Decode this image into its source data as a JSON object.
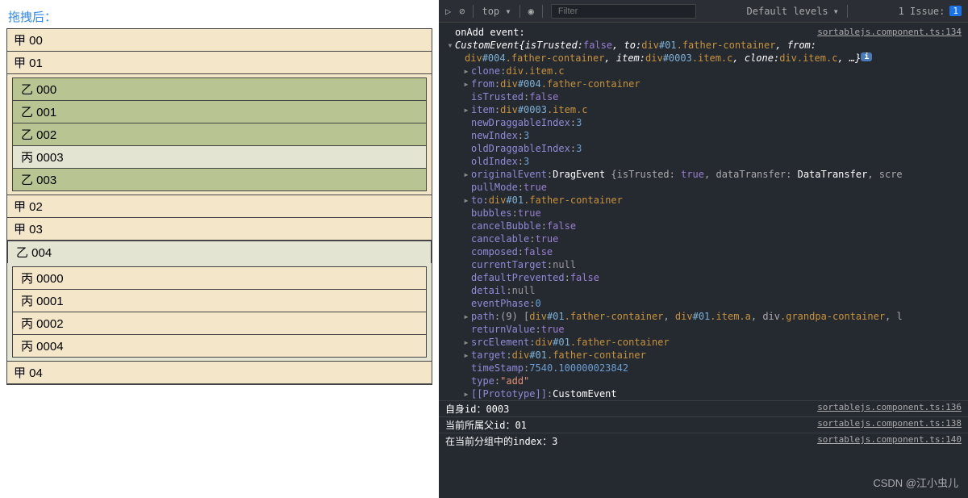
{
  "left": {
    "title": "拖拽后：",
    "itemsA": [
      "甲 00",
      "甲 01"
    ],
    "group1": [
      "乙 000",
      "乙 001",
      "乙 002",
      "丙 0003",
      "乙 003"
    ],
    "group1_c_index": 3,
    "itemsA2": [
      "甲 02",
      "甲 03"
    ],
    "row_b_single": "乙 004",
    "group2": [
      "丙 0000",
      "丙 0001",
      "丙 0002",
      "丙 0004"
    ],
    "itemsA3": [
      "甲 04"
    ]
  },
  "toolbar": {
    "top": "top",
    "filter_placeholder": "Filter",
    "levels": "Default levels",
    "issue_label": "1 Issue:",
    "issue_count": "1"
  },
  "console": {
    "header_label": "onAdd event:",
    "header_src": "sortablejs.component.ts:134",
    "summary_type": "CustomEvent",
    "summary_line1_parts": [
      "{isTrusted: ",
      "false",
      ", to: ",
      "div",
      "#01",
      ".father-container",
      ", from:"
    ],
    "summary_line2_parts": [
      "div",
      "#004",
      ".father-container",
      ", item: ",
      "div",
      "#0003",
      ".item.c",
      ", clone: ",
      "div.item.c",
      ", …}"
    ],
    "props": [
      {
        "tri": true,
        "key": "clone",
        "kind": "sel",
        "val_parts": [
          "div",
          ".item.c"
        ]
      },
      {
        "tri": true,
        "key": "from",
        "kind": "sel",
        "val_parts": [
          "div",
          "#004",
          ".father-container"
        ]
      },
      {
        "tri": false,
        "key": "isTrusted",
        "kind": "bool",
        "val": "false"
      },
      {
        "tri": true,
        "key": "item",
        "kind": "sel",
        "val_parts": [
          "div",
          "#0003",
          ".item.c"
        ]
      },
      {
        "tri": false,
        "key": "newDraggableIndex",
        "kind": "num",
        "val": "3"
      },
      {
        "tri": false,
        "key": "newIndex",
        "kind": "num",
        "val": "3"
      },
      {
        "tri": false,
        "key": "oldDraggableIndex",
        "kind": "num",
        "val": "3"
      },
      {
        "tri": false,
        "key": "oldIndex",
        "kind": "num",
        "val": "3"
      },
      {
        "tri": true,
        "key": "originalEvent",
        "kind": "obj",
        "val": "DragEvent {isTrusted: true, dataTransfer: DataTransfer, scre"
      },
      {
        "tri": false,
        "key": "pullMode",
        "kind": "bool",
        "val": "true"
      },
      {
        "tri": true,
        "key": "to",
        "kind": "sel",
        "val_parts": [
          "div",
          "#01",
          ".father-container"
        ]
      },
      {
        "tri": false,
        "key": "bubbles",
        "kind": "bool",
        "val": "true"
      },
      {
        "tri": false,
        "key": "cancelBubble",
        "kind": "bool",
        "val": "false"
      },
      {
        "tri": false,
        "key": "cancelable",
        "kind": "bool",
        "val": "true"
      },
      {
        "tri": false,
        "key": "composed",
        "kind": "bool",
        "val": "false"
      },
      {
        "tri": false,
        "key": "currentTarget",
        "kind": "null",
        "val": "null"
      },
      {
        "tri": false,
        "key": "defaultPrevented",
        "kind": "bool",
        "val": "false"
      },
      {
        "tri": false,
        "key": "detail",
        "kind": "null",
        "val": "null"
      },
      {
        "tri": false,
        "key": "eventPhase",
        "kind": "num",
        "val": "0"
      },
      {
        "tri": true,
        "key": "path",
        "kind": "path",
        "val": "(9) [div#01.father-container, div#01.item.a, div.grandpa-container, l"
      },
      {
        "tri": false,
        "key": "returnValue",
        "kind": "bool",
        "val": "true"
      },
      {
        "tri": true,
        "key": "srcElement",
        "kind": "sel",
        "val_parts": [
          "div",
          "#01",
          ".father-container"
        ]
      },
      {
        "tri": true,
        "key": "target",
        "kind": "sel",
        "val_parts": [
          "div",
          "#01",
          ".father-container"
        ]
      },
      {
        "tri": false,
        "key": "timeStamp",
        "kind": "num",
        "val": "7540.100000023842"
      },
      {
        "tri": false,
        "key": "type",
        "kind": "str",
        "val": "\"add\""
      },
      {
        "tri": true,
        "key": "[[Prototype]]",
        "kind": "white",
        "val": "CustomEvent"
      }
    ],
    "info_rows": [
      {
        "text": "自身id：0003",
        "src": "sortablejs.component.ts:136"
      },
      {
        "text": "当前所属父id：01",
        "src": "sortablejs.component.ts:138"
      },
      {
        "text": "在当前分组中的index：3",
        "src": "sortablejs.component.ts:140"
      }
    ]
  },
  "watermark": "CSDN @江小虫儿"
}
